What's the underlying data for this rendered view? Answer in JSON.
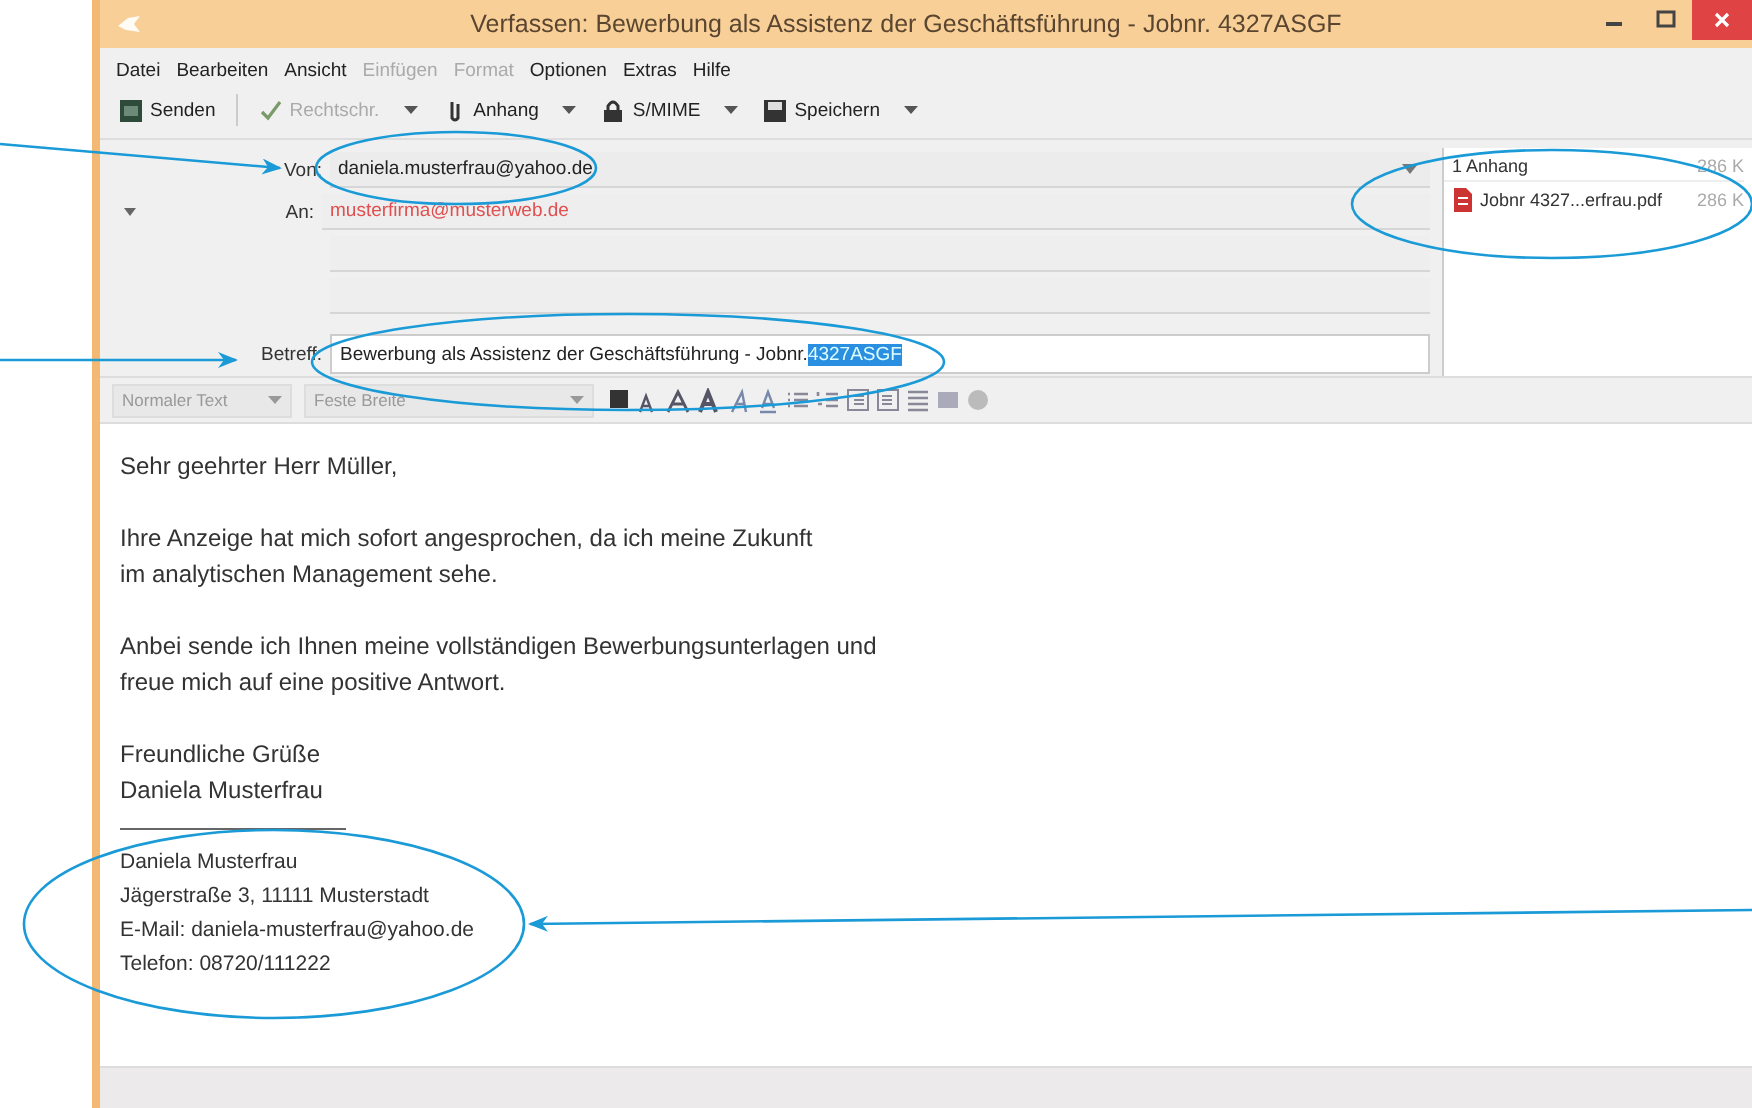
{
  "window": {
    "title": "Verfassen: Bewerbung als Assistenz der Geschäftsführung - Jobnr. 4327ASGF"
  },
  "menu": [
    {
      "label": "Datei",
      "disabled": false
    },
    {
      "label": "Bearbeiten",
      "disabled": false
    },
    {
      "label": "Ansicht",
      "disabled": false
    },
    {
      "label": "Einfügen",
      "disabled": true
    },
    {
      "label": "Format",
      "disabled": true
    },
    {
      "label": "Optionen",
      "disabled": false
    },
    {
      "label": "Extras",
      "disabled": false
    },
    {
      "label": "Hilfe",
      "disabled": false
    }
  ],
  "toolbar": [
    {
      "label": "Senden",
      "disabled": false,
      "dropdown": false
    },
    {
      "label": "Rechtschr.",
      "disabled": true,
      "dropdown": true
    },
    {
      "label": "Anhang",
      "disabled": false,
      "dropdown": true
    },
    {
      "label": "S/MIME",
      "disabled": false,
      "dropdown": true
    },
    {
      "label": "Speichern",
      "disabled": false,
      "dropdown": true
    }
  ],
  "header": {
    "from": {
      "label": "Von:",
      "value": "daniela.musterfrau@yahoo.de"
    },
    "to": {
      "label": "An:",
      "value": "musterfirma@musterweb.de"
    },
    "subject": {
      "label": "Betreff:",
      "value": "Bewerbung als Assistenz der Geschäftsführung - Jobnr. ",
      "selected_text": "4327ASGF"
    }
  },
  "attachments": {
    "heading": "1 Anhang",
    "total_size": "286 K",
    "items": [
      {
        "name": "Jobnr 4327...erfrau.pdf",
        "size": "286 K"
      }
    ]
  },
  "format_bar": {
    "paragraph_format": "Normaler Text",
    "font": "Feste Breite"
  },
  "body": {
    "paragraphs": [
      [
        "Sehr geehrter Herr Müller,"
      ],
      [
        "Ihre Anzeige hat mich sofort angesprochen, da ich meine Zukunft",
        "im analytischen Management sehe."
      ],
      [
        "Anbei sende ich Ihnen meine vollständigen Bewerbungsunterlagen und",
        "freue mich auf eine positive Antwort."
      ],
      [
        "Freundliche Grüße",
        "Daniela Musterfrau"
      ]
    ],
    "signature": [
      "Daniela Musterfrau",
      "Jägerstraße 3, 11111 Musterstadt",
      "E-Mail: daniela-musterfrau@yahoo.de",
      "Telefon: 08720/111222"
    ]
  }
}
